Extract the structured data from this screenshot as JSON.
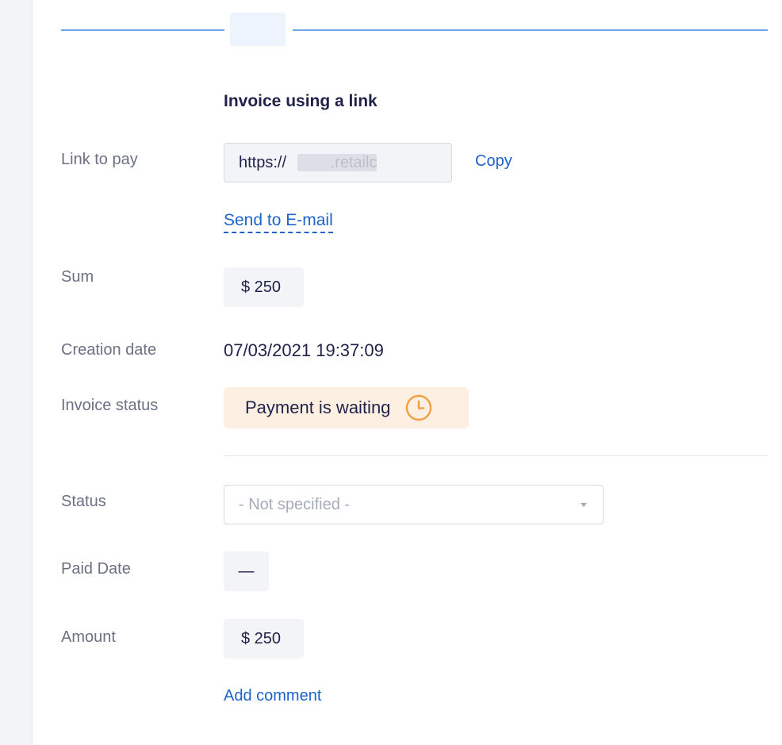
{
  "invoice": {
    "heading": "Invoice using a link",
    "link_to_pay": {
      "label": "Link to pay",
      "value": "https://          .retailc",
      "copy_label": "Copy",
      "send_email_label": "Send to E-mail"
    },
    "sum": {
      "label": "Sum",
      "value": "$ 250"
    },
    "creation_date": {
      "label": "Creation date",
      "value": "07/03/2021 19:37:09"
    },
    "invoice_status": {
      "label": "Invoice status",
      "value": "Payment is waiting",
      "icon": "clock-icon",
      "color": "#f0a043",
      "background": "#fdf0e2"
    }
  },
  "payment": {
    "status": {
      "label": "Status",
      "selected": "- Not specified -"
    },
    "paid_date": {
      "label": "Paid Date",
      "value": "—"
    },
    "amount": {
      "label": "Amount",
      "value": "$ 250"
    },
    "add_comment_label": "Add comment"
  },
  "colors": {
    "accent": "#1d63c9",
    "divider": "#6fa6e6",
    "label": "#6b7183",
    "text": "#1e2248"
  }
}
